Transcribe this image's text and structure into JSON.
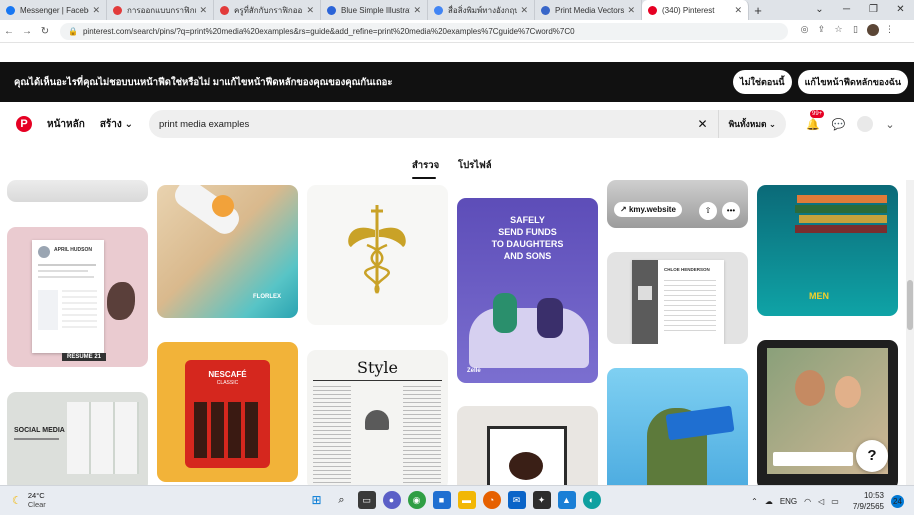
{
  "browser": {
    "tabs": [
      {
        "label": "Messenger | Facebook",
        "color": "#1877f2",
        "active": false
      },
      {
        "label": "การออกแบบกราฟิกเบื้อง",
        "color": "#e23b3b",
        "active": false
      },
      {
        "label": "ครูที่สักกับกราฟิกออกแบบ",
        "color": "#e23b3b",
        "active": false
      },
      {
        "label": "Blue Simple Illustratio",
        "color": "#2b64d8",
        "active": false
      },
      {
        "label": "สื่อสิ่งพิมพ์ทางอังกฤษ",
        "color": "#4285f4",
        "active": false
      },
      {
        "label": "Print Media Vectors, I",
        "color": "#3866c9",
        "active": false
      },
      {
        "label": "(340) Pinterest",
        "color": "#e60023",
        "active": true
      }
    ],
    "url": "pinterest.com/search/pins/?q=print%20media%20examples&rs=guide&add_refine=print%20media%20examples%7Cguide%7Cword%7C0"
  },
  "banner": {
    "text": "คุณได้เห็นอะไรที่คุณไม่ชอบบนหน้าฟีดใช่หรือไม่ มาแก้ไขหน้าฟีดหลักของคุณของคุณกันเถอะ",
    "button_no": "ไม่ใช่ตอนนี้",
    "button_fix": "แก้ไขหน้าฟีดหลักของฉัน"
  },
  "header": {
    "logo": "P",
    "home": "หน้าหลัก",
    "create": "สร้าง",
    "search_value": "print media examples",
    "filter": "พินทั้งหมด",
    "notifications_count": "99+"
  },
  "tabs": {
    "explore": "สำรวจ",
    "profiles": "โปรไฟล์"
  },
  "pins": {
    "resume_name": "APRIL HUDSON",
    "resume_label": "RESUME 21",
    "social_media_title": "SOCIAL MEDIA",
    "beach_brand": "FLORLEX",
    "nescafe_brand": "NESCAFÉ",
    "nescafe_sub": "CLASSIC",
    "style_title": "Style",
    "send_funds_line1": "SAFELY",
    "send_funds_line2": "SEND FUNDS",
    "send_funds_line3": "TO DAUGHTERS",
    "send_funds_line4": "AND SONS",
    "send_funds_brand": "Zelle",
    "kmy_site": "kmy.website",
    "chloe_name": "CHLOE HENDERSON",
    "men_brand": "MEN"
  },
  "taskbar": {
    "temperature": "24°C",
    "condition": "Clear",
    "language": "ENG",
    "time": "10:53",
    "date": "7/9/2565",
    "notification_count": "24"
  }
}
